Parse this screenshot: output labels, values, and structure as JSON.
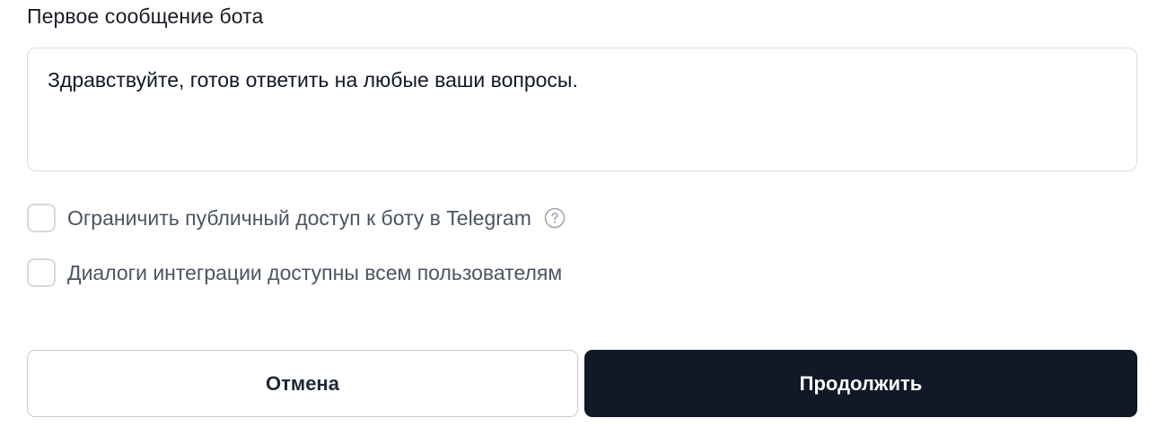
{
  "first_message": {
    "label": "Первое сообщение бота",
    "value": "Здравствуйте, готов ответить на любые ваши вопросы."
  },
  "options": {
    "restrict_access": {
      "label": "Ограничить публичный доступ к боту в Telegram",
      "checked": false,
      "help_icon": "question-circle-icon"
    },
    "dialogs_public": {
      "label": "Диалоги интеграции доступны всем пользователям",
      "checked": false
    }
  },
  "actions": {
    "cancel_label": "Отмена",
    "continue_label": "Продолжить"
  },
  "colors": {
    "primary": "#111827",
    "border": "#d9dce3",
    "muted_text": "#4b5563"
  }
}
